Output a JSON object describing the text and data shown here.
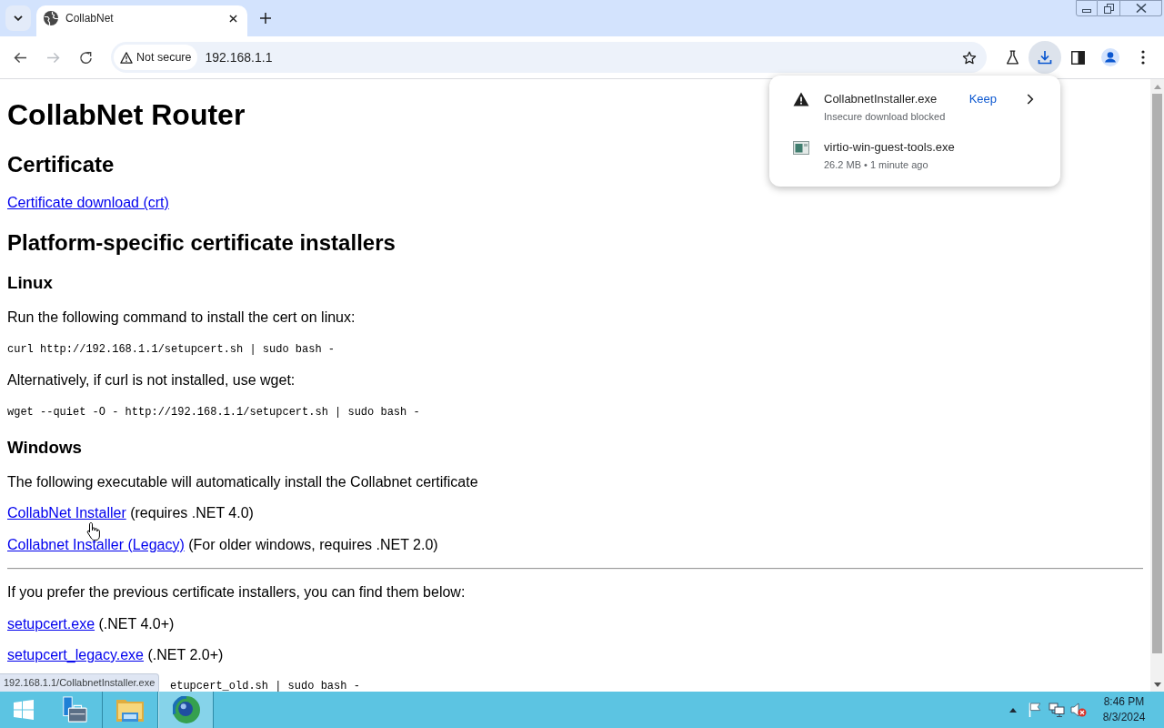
{
  "browser": {
    "tabs": [
      {
        "title": "CollabNet",
        "selected": true
      }
    ],
    "back_disabled": false,
    "forward_disabled": true,
    "address_bar": {
      "security_label": "Not secure",
      "url": "192.168.1.1"
    }
  },
  "page": {
    "blocks": [
      {
        "kind": "h1",
        "text": "CollabNet Router"
      },
      {
        "kind": "h2",
        "text": "Certificate"
      },
      {
        "kind": "link_line",
        "link": "Certificate download (crt)"
      },
      {
        "kind": "h2",
        "text": "Platform-specific certificate installers"
      },
      {
        "kind": "h3",
        "text": "Linux"
      },
      {
        "kind": "p",
        "text": "Run the following command to install the cert on linux:"
      },
      {
        "kind": "code",
        "text": "curl http://192.168.1.1/setupcert.sh | sudo bash -"
      },
      {
        "kind": "p",
        "text": "Alternatively, if curl is not installed, use wget:"
      },
      {
        "kind": "code",
        "text": "wget --quiet -O - http://192.168.1.1/setupcert.sh | sudo bash -"
      },
      {
        "kind": "h3",
        "text": "Windows"
      },
      {
        "kind": "p",
        "text": "The following executable will automatically install the Collabnet certificate"
      },
      {
        "kind": "link_line",
        "link": "CollabNet Installer",
        "note": "(requires .NET 4.0)"
      },
      {
        "kind": "link_line",
        "link": "Collabnet Installer (Legacy)",
        "note": "(For older windows, requires .NET 2.0)"
      },
      {
        "kind": "hr"
      },
      {
        "kind": "p",
        "text": "If you prefer the previous certificate installers, you can find them below:"
      },
      {
        "kind": "link_line",
        "link": "setupcert.exe",
        "note": "(.NET 4.0+)"
      },
      {
        "kind": "link_line",
        "link": "setupcert_legacy.exe",
        "note": "(.NET 2.0+)"
      },
      {
        "kind": "code_partial",
        "text": "etupcert_old.sh | sudo bash -"
      }
    ]
  },
  "status_bubble": {
    "text": "192.168.1.1/CollabnetInstaller.exe"
  },
  "downloads_bubble": {
    "open": true,
    "items": [
      {
        "kind": "blocked",
        "filename": "CollabnetInstaller.exe",
        "status": "Insecure download blocked",
        "action": "Keep"
      },
      {
        "kind": "complete",
        "filename": "virtio-win-guest-tools.exe",
        "status": "26.2 MB • 1 minute ago"
      }
    ]
  },
  "taskbar": {
    "apps": [
      {
        "kind": "server-manager",
        "selected": false
      },
      {
        "kind": "file-explorer",
        "selected": false
      },
      {
        "kind": "browser",
        "selected": true
      }
    ],
    "clock": {
      "time": "8:46 PM",
      "date": "8/3/2024"
    }
  }
}
